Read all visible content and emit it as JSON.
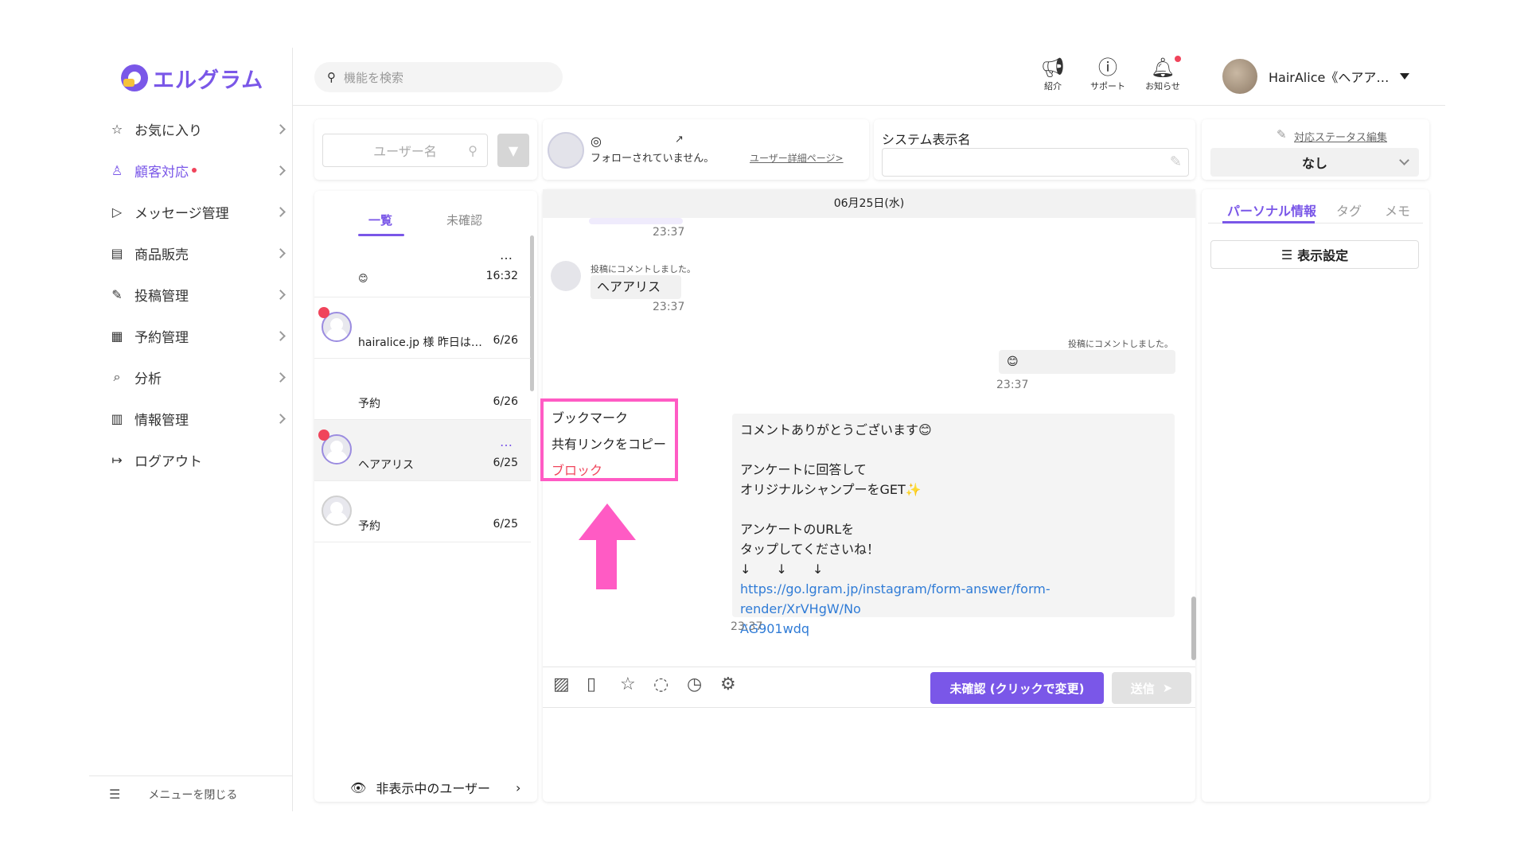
{
  "app": {
    "logo_text": "エルグラム"
  },
  "sidebar": {
    "items": [
      {
        "label": "お気に入り",
        "icon": "star-icon"
      },
      {
        "label": "顧客対応",
        "icon": "user-icon",
        "active": true
      },
      {
        "label": "メッセージ管理",
        "icon": "send-icon"
      },
      {
        "label": "商品販売",
        "icon": "store-icon"
      },
      {
        "label": "投稿管理",
        "icon": "edit-icon"
      },
      {
        "label": "予約管理",
        "icon": "calendar-icon"
      },
      {
        "label": "分析",
        "icon": "report-icon"
      },
      {
        "label": "情報管理",
        "icon": "chart-icon"
      },
      {
        "label": "ログアウト",
        "icon": "logout-icon"
      }
    ],
    "close_menu": "メニューを閉じる"
  },
  "header": {
    "search_placeholder": "機能を検索",
    "icons": [
      {
        "label": "紹介",
        "icon": "megaphone-icon"
      },
      {
        "label": "サポート",
        "icon": "help-icon"
      },
      {
        "label": "お知らせ",
        "icon": "bell-icon"
      }
    ],
    "account_name": "HairAlice《ヘアア…"
  },
  "user_list": {
    "search_placeholder": "ユーザー名",
    "tabs": [
      "一覧",
      "未確認"
    ],
    "rows": [
      {
        "name": "😊",
        "date": "16:32",
        "more": "…"
      },
      {
        "name": "hairalice.jp 様 昨日は…",
        "date": "6/26",
        "unread": true
      },
      {
        "name": "予約",
        "date": "6/26"
      },
      {
        "name": "ヘアアリス",
        "date": "6/25",
        "unread": true,
        "more": "…",
        "selected": true
      },
      {
        "name": "予約",
        "date": "6/25"
      }
    ],
    "hidden_users": "非表示中のユーザー"
  },
  "chat_header": {
    "follow_status": "フォローされていません。",
    "detail_link": "ユーザー詳細ページ>",
    "system_name_label": "システム表示名",
    "system_name_value": ""
  },
  "chat": {
    "date": "06月25日(水)",
    "messages": [
      {
        "time": "23:37"
      },
      {
        "caption": "投稿にコメントしました。",
        "text": "ヘアアリス",
        "time": "23:37"
      },
      {
        "caption": "投稿にコメントしました。",
        "text": "😊",
        "time": "23:37"
      },
      {
        "lines": [
          "コメントありがとうございます😊",
          "",
          "アンケートに回答して",
          "オリジナルシャンプーをGET✨",
          "",
          "アンケートのURLを",
          "タップしてくださいね！",
          "↓　　↓　　↓"
        ],
        "link": "https://go.lgram.jp/instagram/form-answer/form-render/XrVHgW/NoAG901wdq",
        "link_line1": "https://go.lgram.jp/instagram/form-answer/form-render/XrVHgW/No",
        "link_line2": "AG901wdq",
        "time": "23:37"
      }
    ],
    "context_menu": [
      "ブックマーク",
      "共有リンクをコピー",
      "ブロック"
    ]
  },
  "composer": {
    "tools": [
      "image-icon",
      "document-icon",
      "star-icon",
      "eye-off-icon",
      "timer-icon",
      "gear-icon"
    ],
    "status_button": "未確認 (クリックで変更)",
    "send_button": "送信"
  },
  "right_panel": {
    "edit_status": "対応ステータス編集",
    "status_value": "なし",
    "tabs": [
      "パーソナル情報",
      "タグ",
      "メモ"
    ],
    "display_settings": "表示設定"
  },
  "colors": {
    "accent": "#7a57e8",
    "alert": "#f0445b",
    "highlight": "#ff5bc4",
    "link": "#2f7bd6"
  }
}
